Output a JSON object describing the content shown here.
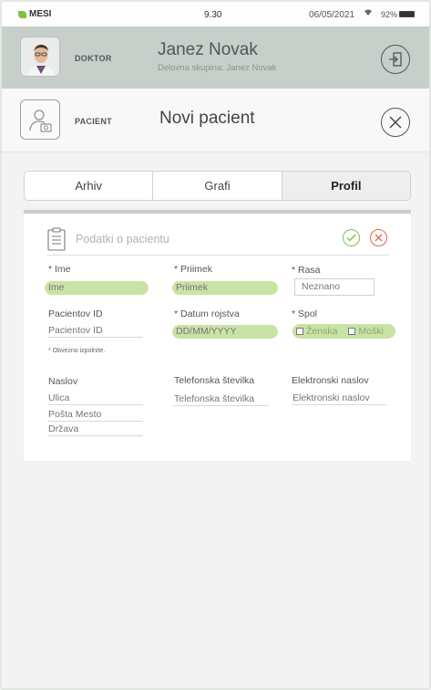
{
  "status_bar": {
    "carrier": "MESI",
    "time": "9.30",
    "date": "06/05/2021",
    "battery": "92%"
  },
  "doctor": {
    "role": "DOKTOR",
    "name": "Janez Novak",
    "group": "Delovna skupina: Janez Novak"
  },
  "patient": {
    "role": "PACIENT",
    "title": "Novi pacient"
  },
  "tabs": [
    {
      "label": "Arhiv"
    },
    {
      "label": "Grafi"
    },
    {
      "label": "Profil",
      "active": true
    }
  ],
  "form": {
    "title": "Podatki o pacientu",
    "first_name": {
      "label": "* Ime",
      "placeholder": "Ime"
    },
    "last_name": {
      "label": "* Priimek",
      "placeholder": "Priimek"
    },
    "race": {
      "label": "* Rasa",
      "value": "Neznano"
    },
    "patient_id": {
      "label": "Pacientov ID",
      "placeholder": "Pacientov ID"
    },
    "birth_date": {
      "label": "* Datum rojstva",
      "placeholder": "DD/MM/YYYY"
    },
    "sex": {
      "label": "* Spol",
      "options": [
        "Ženska",
        "Moški"
      ]
    },
    "required_note": "* Obvezno izpolnite.",
    "address": {
      "label": "Naslov",
      "street": "Ulica",
      "post_city": "Pošta Mesto",
      "country": "Država"
    },
    "phone": {
      "label": "Telefonska številka",
      "placeholder": "Telefonska številka"
    },
    "email": {
      "label": "Elektronski naslov",
      "placeholder": "Elektronski naslov"
    }
  },
  "colors": {
    "accent_green": "#7fc241",
    "cancel_red": "#e0664b",
    "header_bg": "#c6cfc9",
    "required_fill": "#c9e3a6"
  }
}
